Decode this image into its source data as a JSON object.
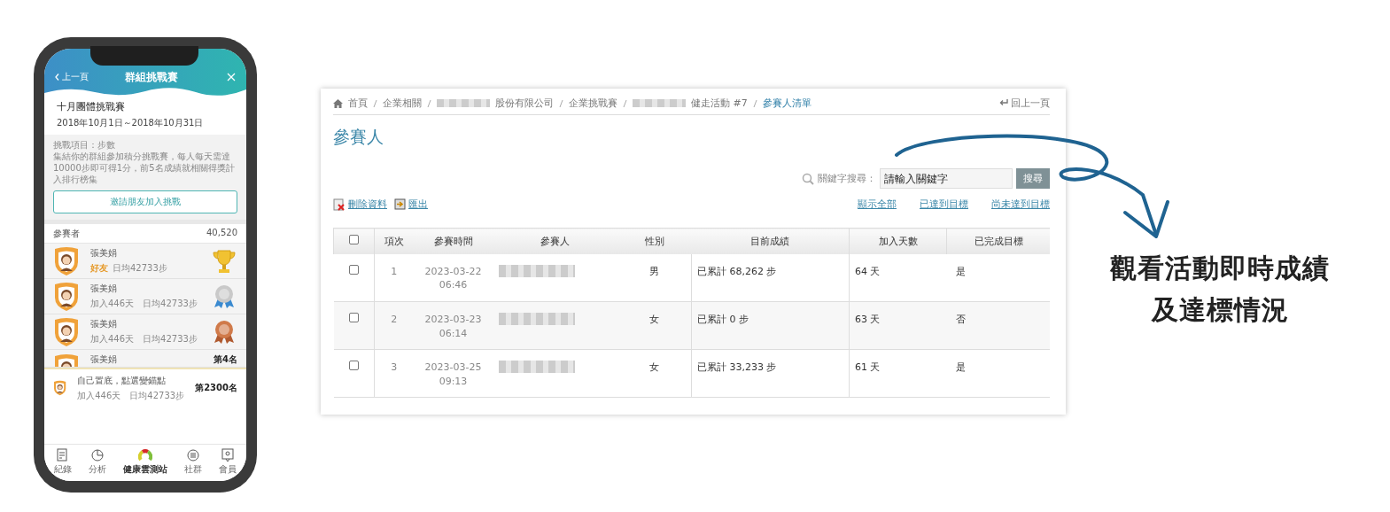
{
  "phone": {
    "header": {
      "back": "上一頁",
      "title": "群組挑戰賽"
    },
    "event": {
      "title": "十月團體挑戰賽",
      "dates": "2018年10月1日～2018年10月31日"
    },
    "info": {
      "item": "挑戰項目：步數",
      "description": "集結你的群組參加積分挑戰賽，每人每天需達10000步即可得1分，前5名成績就相關得獎計入排行榜集"
    },
    "invite_button": "邀請朋友加入挑戰",
    "participants": {
      "label": "參賽者",
      "total": "40,520"
    },
    "rows": [
      {
        "name": "張美娟",
        "tag": "好友",
        "stats": "日均42733步",
        "kind": "gold"
      },
      {
        "name": "張美娟",
        "stats": "加入446天　日均42733步",
        "kind": "silver"
      },
      {
        "name": "張美娟",
        "stats": "加入446天　日均42733步",
        "kind": "bronze"
      },
      {
        "name": "張美娟",
        "rank": "第4名",
        "kind": "text"
      }
    ],
    "self_row": {
      "name": "自己置底，點選變錨點",
      "stats": "加入446天　日均42733步",
      "rank": "第2300名"
    },
    "tabs": [
      {
        "label": "紀錄",
        "kind": "note",
        "selected": false
      },
      {
        "label": "分析",
        "kind": "pie",
        "selected": false
      },
      {
        "label": "健康雲測站",
        "kind": "gauge",
        "selected": true
      },
      {
        "label": "社群",
        "kind": "chat",
        "selected": false
      },
      {
        "label": "會員",
        "kind": "member",
        "selected": false
      }
    ]
  },
  "web": {
    "breadcrumb": [
      {
        "label": "首頁",
        "kind": "home",
        "blurred": false,
        "current": false
      },
      {
        "label": "企業相關",
        "kind": "link",
        "blurred": false,
        "current": false
      },
      {
        "label": "股份有限公司",
        "kind": "link",
        "blurred": true,
        "current": false
      },
      {
        "label": "企業挑戰賽",
        "kind": "link",
        "blurred": false,
        "current": false
      },
      {
        "label": "健走活動 #7",
        "kind": "link",
        "blurred": true,
        "current": false
      },
      {
        "label": "參賽人清單",
        "kind": "link",
        "current": true,
        "blurred": false
      }
    ],
    "back_link": "回上一頁",
    "title": "參賽人",
    "search": {
      "label": "關鍵字搜尋：",
      "placeholder": "請輸入關鍵字",
      "button": "搜尋"
    },
    "actions": [
      "刪除資料",
      "匯出"
    ],
    "filters": [
      "顯示全部",
      "已達到目標",
      "尚未達到目標"
    ],
    "table": {
      "select_all_checked": false,
      "columns": [
        "項次",
        "參賽時間",
        "參賽人",
        "性別",
        "目前成績",
        "加入天數",
        "已完成目標"
      ],
      "rows": [
        {
          "checked": false,
          "index": "1",
          "date": "2023-03-22",
          "time": "06:46",
          "gender": "男",
          "score": "已累計 68,262 步",
          "days": "64 天",
          "done": "是"
        },
        {
          "checked": false,
          "index": "2",
          "date": "2023-03-23",
          "time": "06:14",
          "gender": "女",
          "score": "已累計 0 步",
          "days": "63 天",
          "done": "否"
        },
        {
          "checked": false,
          "index": "3",
          "date": "2023-03-25",
          "time": "09:13",
          "gender": "女",
          "score": "已累計 33,233 步",
          "days": "61 天",
          "done": "是"
        }
      ]
    }
  },
  "caption": [
    "觀看活動即時成績",
    "及達標情況"
  ]
}
